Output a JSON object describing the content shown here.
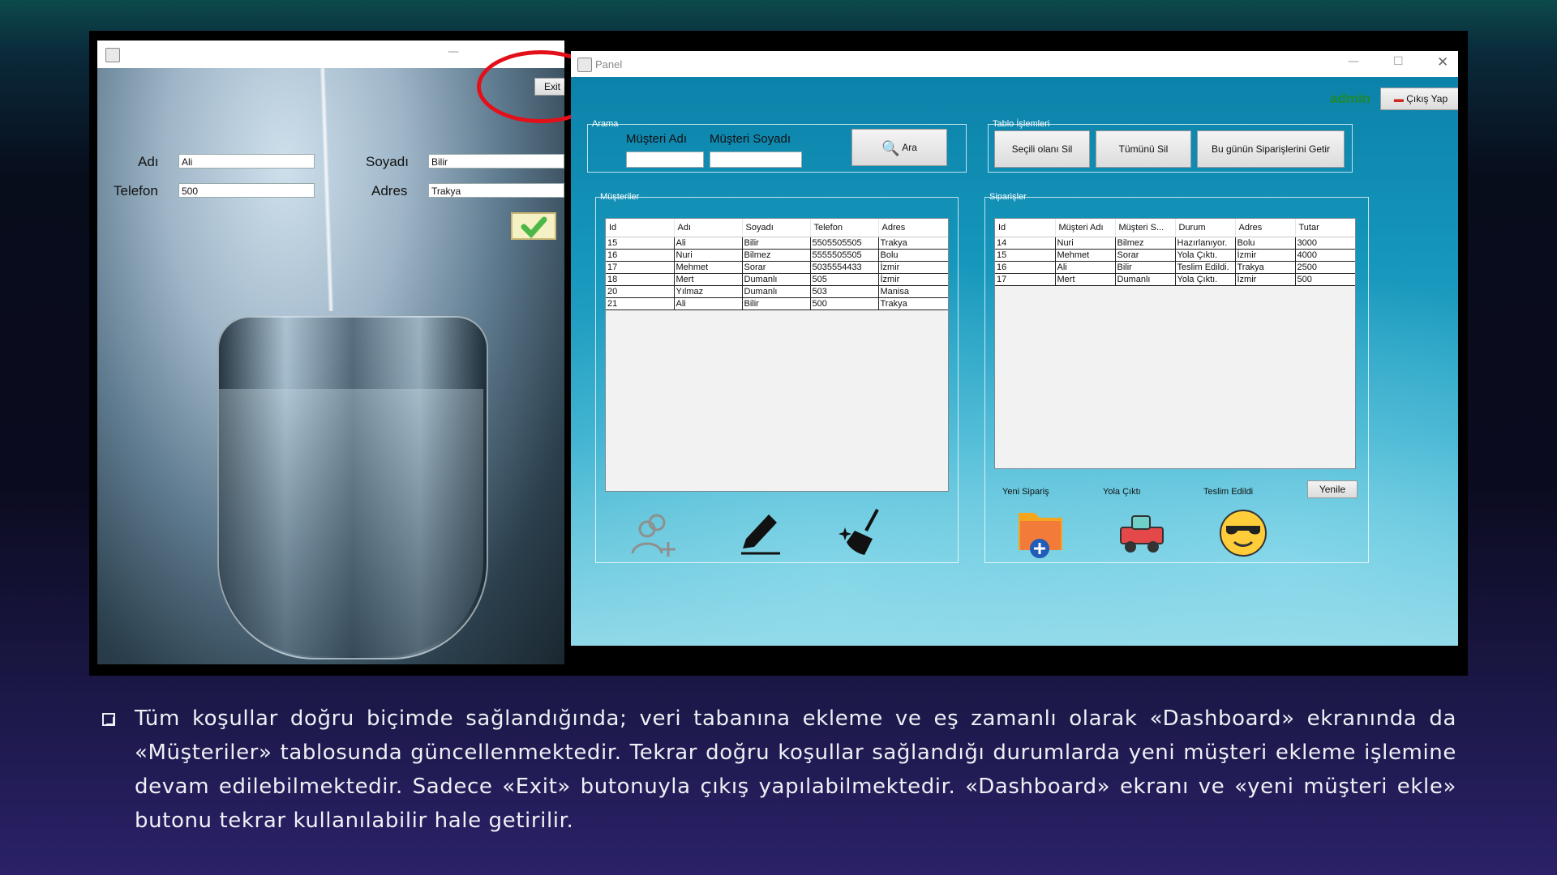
{
  "left_window": {
    "exit_label": "Exit",
    "fields": {
      "adi_label": "Adı",
      "adi_value": "Ali",
      "soyadi_label": "Soyadı",
      "soyadi_value": "Bilir",
      "telefon_label": "Telefon",
      "telefon_value": "500",
      "adres_label": "Adres",
      "adres_value": "Trakya"
    }
  },
  "panel": {
    "title": "Panel",
    "user": "admin",
    "logout_label": "Çıkış Yap",
    "search": {
      "group_label": "Arama",
      "first_name_label": "Müşteri Adı",
      "last_name_label": "Müşteri Soyadı",
      "search_button": "Ara"
    },
    "table_ops": {
      "group_label": "Tablo İşlemleri",
      "delete_selected": "Seçili olanı Sil",
      "delete_all": "Tümünü Sil",
      "today_orders": "Bu günün Siparişlerini Getir"
    },
    "customers": {
      "group_label": "Müşteriler",
      "columns": [
        "Id",
        "Adı",
        "Soyadı",
        "Telefon",
        "Adres"
      ],
      "rows": [
        [
          "15",
          "Ali",
          "Bilir",
          "5505505505",
          "Trakya"
        ],
        [
          "16",
          "Nuri",
          "Bilmez",
          "5555505505",
          "Bolu"
        ],
        [
          "17",
          "Mehmet",
          "Sorar",
          "5035554433",
          "İzmir"
        ],
        [
          "18",
          "Mert",
          "Dumanlı",
          "505",
          "İzmir"
        ],
        [
          "20",
          "Yılmaz",
          "Dumanlı",
          "503",
          "Manisa"
        ],
        [
          "21",
          "Ali",
          "Bilir",
          "500",
          "Trakya"
        ]
      ]
    },
    "orders": {
      "group_label": "Siparişler",
      "columns": [
        "Id",
        "Müşteri Adı",
        "Müşteri S...",
        "Durum",
        "Adres",
        "Tutar"
      ],
      "rows": [
        [
          "14",
          "Nuri",
          "Bilmez",
          "Hazırlanıyor.",
          "Bolu",
          "3000"
        ],
        [
          "15",
          "Mehmet",
          "Sorar",
          "Yola Çıktı.",
          "İzmir",
          "4000"
        ],
        [
          "16",
          "Ali",
          "Bilir",
          "Teslim Edildi.",
          "Trakya",
          "2500"
        ],
        [
          "17",
          "Mert",
          "Dumanlı",
          "Yola Çıktı.",
          "İzmir",
          "500"
        ]
      ],
      "new_order_label": "Yeni Sipariş",
      "on_the_way_label": "Yola Çıktı",
      "delivered_label": "Teslim Edildi",
      "refresh_label": "Yenile"
    }
  },
  "caption": "Tüm koşullar doğru biçimde sağlandığında; veri tabanına ekleme ve eş zamanlı olarak «Dashboard» ekranında da «Müşteriler» tablosunda güncellenmektedir. Tekrar doğru koşullar sağlandığı durumlarda yeni müşteri ekleme işlemine devam edilebilmektedir. Sadece «Exit» butonuyla çıkış yapılabilmektedir. «Dashboard» ekranı ve «yeni müşteri ekle» butonu tekrar kullanılabilir hale getirilir.",
  "colors": {
    "accent_red": "#e3101a",
    "admin_green": "#1f8a2a"
  }
}
